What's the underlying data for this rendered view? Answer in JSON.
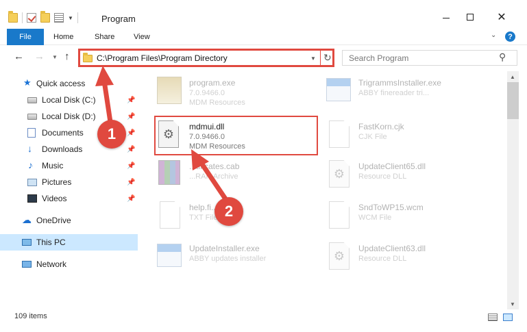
{
  "window": {
    "title": "Program",
    "minimize_glyph": "",
    "close_glyph": "✕"
  },
  "ribbon": {
    "tabs": [
      "File",
      "Home",
      "Share",
      "View"
    ],
    "expand_glyph": "⌄",
    "help_glyph": "?"
  },
  "navigation": {
    "back_glyph": "←",
    "forward_glyph": "→",
    "recent_glyph": "⌄",
    "up_glyph": "↑",
    "address": "C:\\Program Files\\Program Directory",
    "address_dropdown_glyph": "⌄",
    "refresh_glyph": "↻",
    "search_placeholder": "Search Program",
    "search_glyph": "⚲"
  },
  "sidebar": {
    "items": [
      {
        "label": "Quick access",
        "icon": "star-icon",
        "glyph": "★",
        "pinned": false
      },
      {
        "label": "Local Disk (C:)",
        "icon": "disk-icon",
        "pinned": true
      },
      {
        "label": "Local Disk (D:)",
        "icon": "disk-icon",
        "pinned": true
      },
      {
        "label": "Documents",
        "icon": "documents-icon",
        "pinned": true
      },
      {
        "label": "Downloads",
        "icon": "downloads-icon",
        "glyph": "↓",
        "pinned": true
      },
      {
        "label": "Music",
        "icon": "music-icon",
        "glyph": "♪",
        "pinned": true
      },
      {
        "label": "Pictures",
        "icon": "pictures-icon",
        "pinned": true
      },
      {
        "label": "Videos",
        "icon": "videos-icon",
        "pinned": true
      },
      {
        "label": "OneDrive",
        "icon": "cloud-icon",
        "glyph": "☁",
        "pinned": false
      },
      {
        "label": "This PC",
        "icon": "computer-icon",
        "pinned": false,
        "selected": true
      },
      {
        "label": "Network",
        "icon": "network-icon",
        "pinned": false
      }
    ],
    "pin_glyph": "📌"
  },
  "files": [
    {
      "name": "program.exe",
      "meta1": "7.0.9466.0",
      "meta2": "MDM Resources",
      "icon": "setup-exe-icon",
      "faded": true
    },
    {
      "name": "TrigrammsInstaller.exe",
      "meta1": "ABBY finereader tri...",
      "meta2": "",
      "icon": "exe-icon",
      "faded": true
    },
    {
      "name": "mdmui.dll",
      "meta1": "7.0.9466.0",
      "meta2": "MDM Resources",
      "icon": "dll-gear-icon",
      "faded": false,
      "highlighted": true
    },
    {
      "name": "FastKorn.cjk",
      "meta1": "CJK File",
      "meta2": "",
      "icon": "blank-file-icon",
      "faded": true
    },
    {
      "name": "...tificates.cab",
      "meta1": "...RAR Archive",
      "meta2": "",
      "icon": "rar-archive-icon",
      "faded": true
    },
    {
      "name": "UpdateClient65.dll",
      "meta1": "Resource DLL",
      "meta2": "",
      "icon": "dll-gear-icon",
      "faded": true
    },
    {
      "name": "help.fi...der.txt",
      "meta1": "TXT File",
      "meta2": "",
      "icon": "text-file-icon",
      "faded": true
    },
    {
      "name": "SndToWP15.wcm",
      "meta1": "WCM File",
      "meta2": "",
      "icon": "blank-file-icon",
      "faded": true
    },
    {
      "name": "UpdateInstaller.exe",
      "meta1": "ABBY updates installer",
      "meta2": "",
      "icon": "exe-icon",
      "faded": true
    },
    {
      "name": "UpdateClient63.dll",
      "meta1": "Resource DLL",
      "meta2": "",
      "icon": "dll-gear-icon",
      "faded": true
    }
  ],
  "gear_glyph": "⚙",
  "scrollbar": {
    "up_glyph": "▲",
    "down_glyph": "▼"
  },
  "status": {
    "item_count": "109 items"
  },
  "annotations": {
    "step1": "1",
    "step2": "2",
    "color": "#e0493f"
  },
  "colors": {
    "accent": "#1979ca",
    "selection": "#cce8ff",
    "callout": "#e0493f"
  }
}
